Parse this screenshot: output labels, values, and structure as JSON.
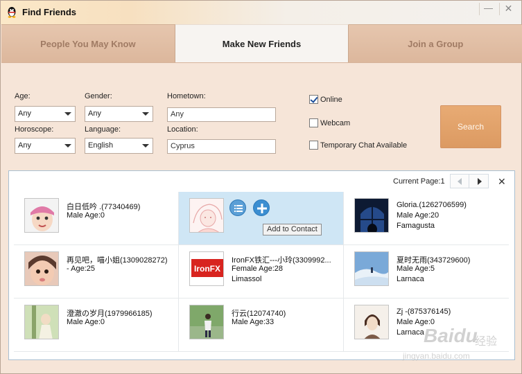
{
  "window": {
    "title": "Find Friends",
    "minimize_glyph": "—",
    "close_glyph": "✕"
  },
  "tabs": [
    {
      "label": "People You May Know",
      "active": false
    },
    {
      "label": "Make New Friends",
      "active": true
    },
    {
      "label": "Join a Group",
      "active": false
    }
  ],
  "filters": {
    "age": {
      "label": "Age:",
      "value": "Any"
    },
    "gender": {
      "label": "Gender:",
      "value": "Any"
    },
    "hometown": {
      "label": "Hometown:",
      "value": "Any"
    },
    "horoscope": {
      "label": "Horoscope:",
      "value": "Any"
    },
    "language": {
      "label": "Language:",
      "value": "English"
    },
    "location": {
      "label": "Location:",
      "value": "Cyprus"
    },
    "online": {
      "label": "Online",
      "checked": true
    },
    "webcam": {
      "label": "Webcam",
      "checked": false
    },
    "temp_chat": {
      "label": "Temporary Chat Available",
      "checked": false
    },
    "search_label": "Search"
  },
  "results": {
    "current_page_label": "Current Page:1",
    "close_glyph": "✕",
    "add_to_contact_label": "Add to Contact",
    "people": [
      {
        "name": "白日低吟 .(77340469)",
        "info": "Male  Age:0",
        "location": ""
      },
      {
        "name": "",
        "info": "",
        "location": ""
      },
      {
        "name": "Gloria.(1262706599)",
        "info": "Male  Age:20",
        "location": "Famagusta"
      },
      {
        "name": "再见吧，喵小姐(1309028272)",
        "info": "-  Age:25",
        "location": ""
      },
      {
        "name": "IronFX铁汇---小玲(3309992...",
        "info": "Female  Age:28",
        "location": "Limassol"
      },
      {
        "name": "夏时无雨(343729600)",
        "info": "Male  Age:5",
        "location": "Larnaca"
      },
      {
        "name": "澄澈の岁月(1979966185)",
        "info": "Male  Age:0",
        "location": ""
      },
      {
        "name": "行云(12074740)",
        "info": "Male  Age:33",
        "location": ""
      },
      {
        "name": "Zj -(875376145)",
        "info": "Male  Age:0",
        "location": "Larnaca"
      }
    ],
    "ironfx_logo_text": "IronFX"
  },
  "watermark": {
    "brand": "Baidu",
    "cn": "经验",
    "url": "jingyan.baidu.com"
  },
  "colors": {
    "accent_button": "#dc9a62",
    "selection": "#cfe6f5",
    "panel_bg": "#f6e5d8"
  }
}
